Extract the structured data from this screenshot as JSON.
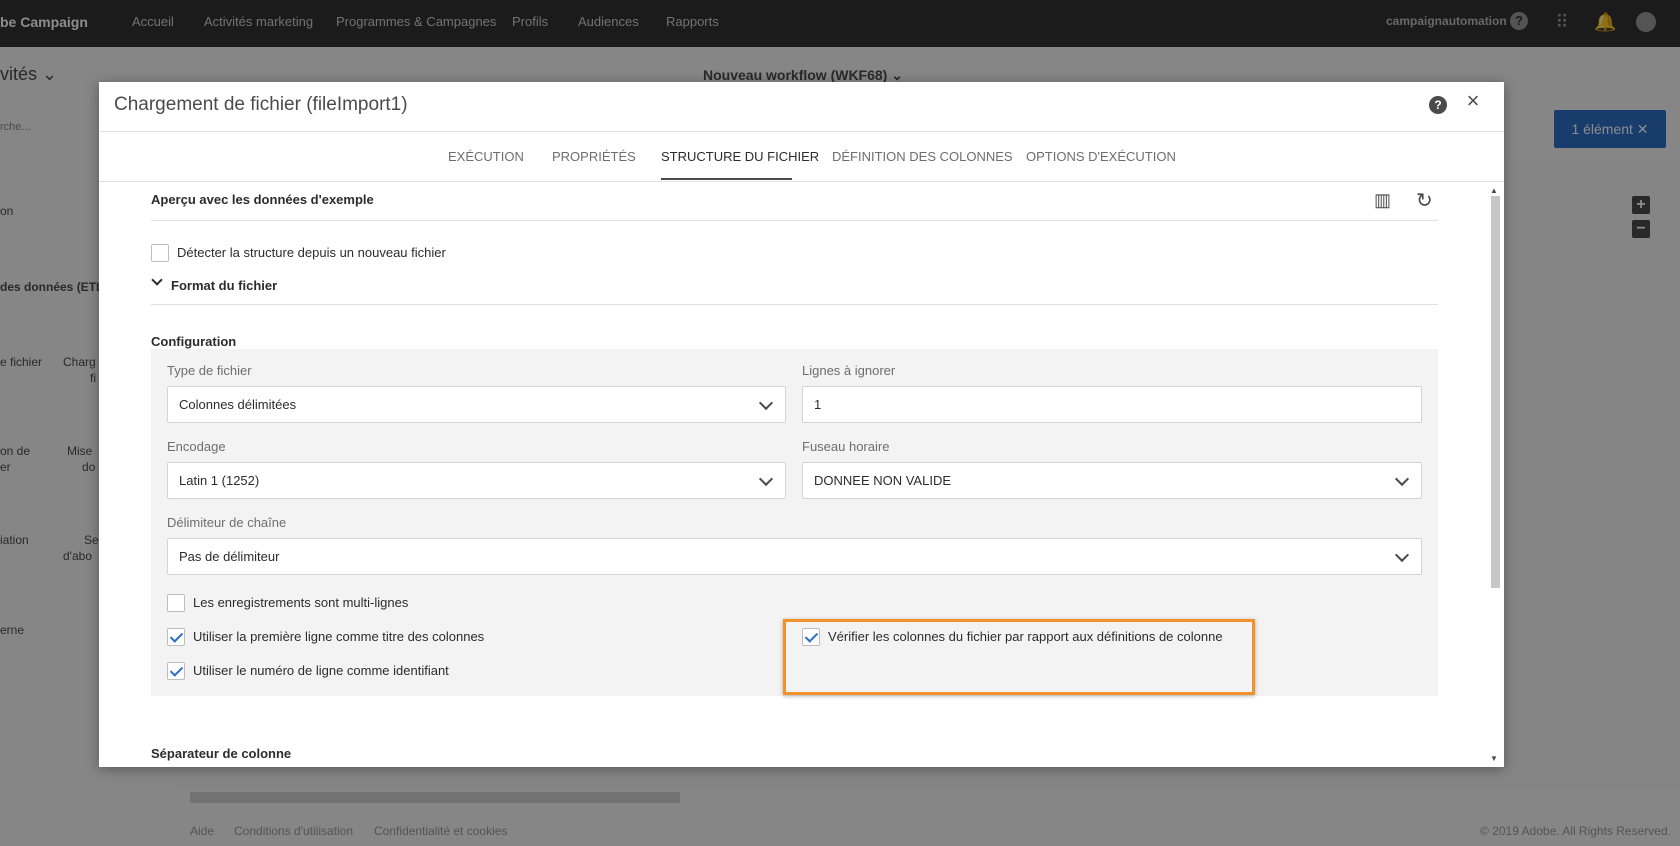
{
  "topbar": {
    "brand": "be Campaign",
    "nav": [
      "Accueil",
      "Activités marketing",
      "Programmes & Campagnes",
      "Profils",
      "Audiences",
      "Rapports"
    ],
    "user": "campaignautomation"
  },
  "background": {
    "page_title": "vités ⌄",
    "search_placeholder": "rche...",
    "workflow_title": "Nouveau workflow (WKF68) ⌄",
    "selection_pill": "1 élément ✕",
    "sidebar_texts": [
      "on",
      "des données (ETL",
      "e fichier",
      "Charg",
      "fi",
      "on de",
      "er",
      "Mise",
      "do",
      "iation",
      "Se",
      "d'abo",
      "erne"
    ],
    "footer": [
      "Aide",
      "Conditions d'utilisation",
      "Confidentialité et cookies",
      "© 2019 Adobe. All Rights Reserved."
    ]
  },
  "modal": {
    "title": "Chargement de fichier (fileImport1)",
    "tabs": [
      "EXÉCUTION",
      "PROPRIÉTÉS",
      "STRUCTURE DU FICHIER",
      "DÉFINITION DES COLONNES",
      "OPTIONS D'EXÉCUTION"
    ],
    "active_tab": "STRUCTURE DU FICHIER",
    "preview_title": "Aperçu avec les données d'exemple",
    "detect_label": "Détecter la structure depuis un nouveau fichier",
    "format_label": "Format du fichier",
    "config_title": "Configuration",
    "fields": {
      "file_type": {
        "label": "Type de fichier",
        "value": "Colonnes délimitées"
      },
      "skip_lines": {
        "label": "Lignes à ignorer",
        "value": "1"
      },
      "encoding": {
        "label": "Encodage",
        "value": "Latin 1 (1252)"
      },
      "timezone": {
        "label": "Fuseau horaire",
        "value": "DONNEE NON VALIDE"
      },
      "string_delimiter": {
        "label": "Délimiteur de chaîne",
        "value": "Pas de délimiteur"
      }
    },
    "checkboxes": {
      "multiline": {
        "label": "Les enregistrements sont multi-lignes",
        "checked": false
      },
      "first_line_titles": {
        "label": "Utiliser la première ligne comme titre des colonnes",
        "checked": true
      },
      "line_number_id": {
        "label": "Utiliser le numéro de ligne comme identifiant",
        "checked": true
      },
      "verify_columns": {
        "label": "Vérifier les colonnes du fichier par rapport aux définitions de colonne",
        "checked": true
      }
    },
    "separator_title": "Séparateur de colonne"
  },
  "colors": {
    "accent": "#2c6fc7",
    "highlight": "#f0922b",
    "topbar": "#323232"
  }
}
